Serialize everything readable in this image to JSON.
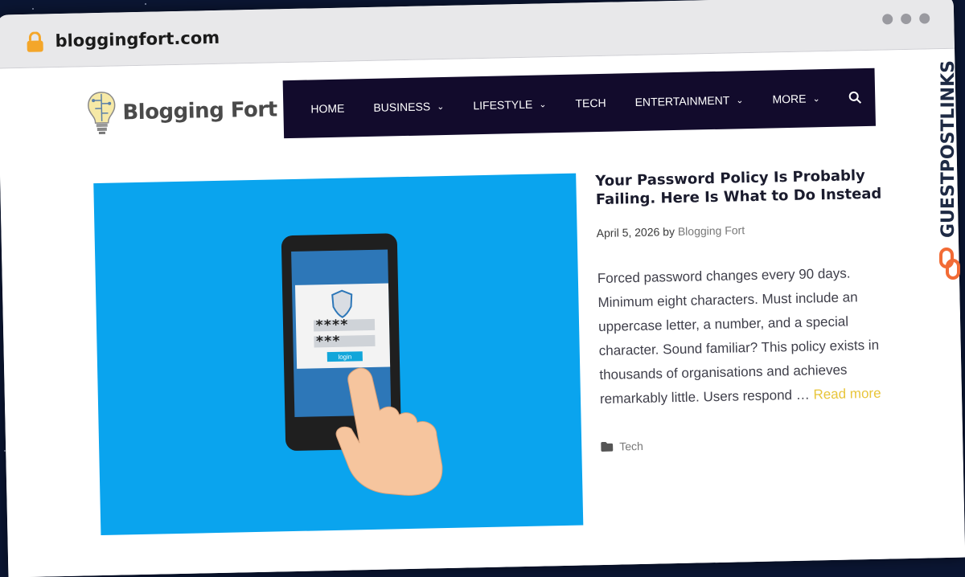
{
  "browser": {
    "url": "bloggingfort.com",
    "lock_icon": "lock-icon"
  },
  "site": {
    "logo_text": "Blogging Fort"
  },
  "nav": {
    "items": [
      {
        "label": "HOME",
        "has_dropdown": false
      },
      {
        "label": "BUSINESS",
        "has_dropdown": true
      },
      {
        "label": "LIFESTYLE",
        "has_dropdown": true
      },
      {
        "label": "TECH",
        "has_dropdown": false
      },
      {
        "label": "ENTERTAINMENT",
        "has_dropdown": true
      },
      {
        "label": "MORE",
        "has_dropdown": true
      }
    ],
    "search_icon": "search-icon",
    "background": "#120b2c"
  },
  "post": {
    "title": "Your Password Policy Is Probably Failing. Here Is What to Do Instead",
    "date": "April 5, 2026",
    "by": "by",
    "author": "Blogging Fort",
    "excerpt": "Forced password changes every 90 days. Minimum eight characters. Must include an uppercase letter, a number, and a special character. Sound familiar? This policy exists in thousands of organisations and achieves remarkably little. Users respond …",
    "read_more": "Read more",
    "category": "Tech",
    "image": {
      "password1": "****",
      "password2": "***",
      "login_label": "login",
      "background": "#0aa4ee"
    }
  },
  "watermark": {
    "text": "GUESTPOSTLINKS"
  }
}
